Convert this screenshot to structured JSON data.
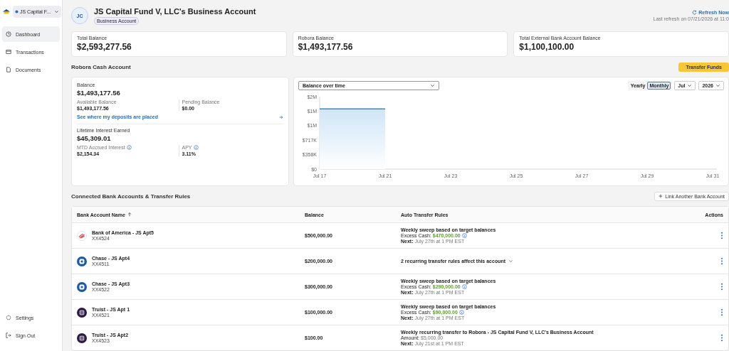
{
  "sidebar": {
    "account_switcher": "JS Capital F...",
    "items": [
      {
        "label": "Dashboard",
        "selected": true
      },
      {
        "label": "Transactions",
        "selected": false
      },
      {
        "label": "Documents",
        "selected": false
      }
    ],
    "footer_items": [
      {
        "label": "Settings"
      },
      {
        "label": "Sign Out"
      }
    ]
  },
  "header": {
    "avatar": "JC",
    "title": "JS Capital Fund V, LLC's Business Account",
    "badge": "Business Account",
    "refresh": "Refresh Now",
    "last_refresh": "Last refresh on 07/21/2026 at 11:0"
  },
  "summary_cards": [
    {
      "label": "Total Balance",
      "value": "$2,593,277.56"
    },
    {
      "label": "Robora Balance",
      "value": "$1,493,177.56"
    },
    {
      "label": "Total External Bank Account Balance",
      "value": "$1,100,100.00"
    }
  ],
  "cash_account": {
    "title": "Robora Cash Account",
    "transfer_button": "Transfer Funds",
    "balance_label": "Balance",
    "balance": "$1,493,177.56",
    "available_label": "Available Balance",
    "available": "$1,493,177.56",
    "pending_label": "Pending Balance",
    "pending": "$0.00",
    "deposits_link": "See where my deposits are placed",
    "interest_label": "Lifetime Interest Earned",
    "interest": "$45,309.01",
    "mtd_label": "MTD Accrued Interest",
    "mtd": "$2,154.34",
    "apy_label": "APY",
    "apy": "3.11%"
  },
  "chart_panel": {
    "select": "Balance over time",
    "toggle": [
      {
        "label": "Yearly",
        "selected": false
      },
      {
        "label": "Monthly",
        "selected": true
      }
    ],
    "month": "Jul",
    "year": "2026",
    "chart_data": {
      "type": "area",
      "categories": [
        "Jul 17",
        "Jul 21",
        "Jul 23",
        "Jul 25",
        "Jul 27",
        "Jul 29",
        "Jul 31"
      ],
      "series": [
        {
          "color": "#2a8fc9",
          "values": [
            1490000,
            1490000,
            null,
            null,
            null,
            null,
            null
          ]
        }
      ],
      "ylim": [
        0,
        1792500
      ],
      "yticks": [
        {
          "value": 0,
          "label": "$0"
        },
        {
          "value": 358500,
          "label": "$358K"
        },
        {
          "value": 717000,
          "label": "$717K"
        },
        {
          "value": 1075500,
          "label": "$1M"
        },
        {
          "value": 1434000,
          "label": "$1M"
        },
        {
          "value": 1792500,
          "label": "$2M"
        }
      ]
    }
  },
  "connected": {
    "title": "Connected Bank Accounts & Transfer Rules",
    "link_button": "Link Another Bank Account",
    "columns": [
      "Bank Account Name",
      "Balance",
      "Auto Transfer Rules",
      "Actions"
    ],
    "rows": [
      {
        "kind": "stripes",
        "name": "Bank of America - JS Apt5",
        "number": "XX4524",
        "balance": "$500,000.00",
        "rule": {
          "kind": "sweep",
          "title": "Weekly sweep based on target balances",
          "amount_label": "Excess Cash:",
          "amount": "$470,000.00",
          "next_label": "Next:",
          "next": "July 27th at 1 PM EST"
        }
      },
      {
        "kind": "octagon",
        "name": "Chase - JS Apt4",
        "number": "XX4511",
        "balance": "$200,000.00",
        "rule": {
          "kind": "collapsed",
          "title": "2 recurring transfer rules affect this account"
        }
      },
      {
        "kind": "octagon",
        "name": "Chase - JS Apt3",
        "number": "XX4522",
        "balance": "$300,000.00",
        "rule": {
          "kind": "sweep",
          "title": "Weekly sweep based on target balances",
          "amount_label": "Excess Cash:",
          "amount": "$290,000.00",
          "next_label": "Next:",
          "next": "July 27th at 1 PM EST"
        }
      },
      {
        "kind": "grid",
        "name": "Truist - JS Apt 1",
        "number": "XX4521",
        "balance": "$100,000.00",
        "rule": {
          "kind": "sweep",
          "title": "Weekly sweep based on target balances",
          "amount_label": "Excess Cash:",
          "amount": "$90,000.00",
          "next_label": "Next:",
          "next": "July 27th at 1 PM EST"
        }
      },
      {
        "kind": "grid",
        "name": "Truist - JS Apt2",
        "number": "XX4523",
        "balance": "$100.00",
        "rule": {
          "kind": "recurring",
          "title": "Weekly recurring transfer to Robora - JS Capital Fund V, LLC's Business Account",
          "amount_label": "Amount:",
          "amount": "$5,000.00",
          "next_label": "Next:",
          "next": "July 21st at 1 PM EST"
        }
      }
    ]
  }
}
